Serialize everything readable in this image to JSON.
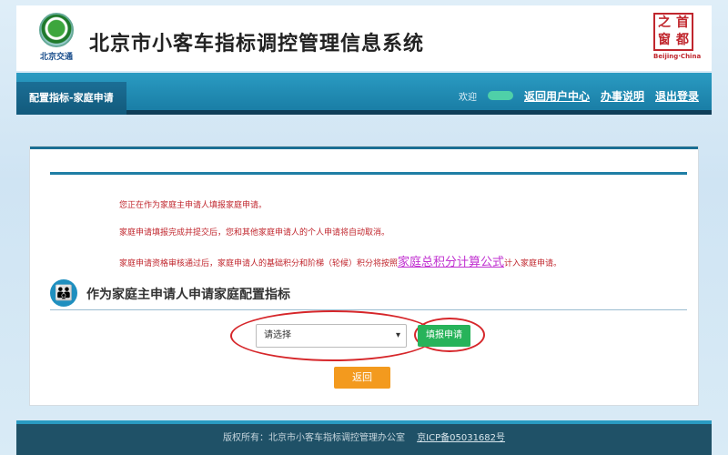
{
  "header": {
    "logo_caption": "北京交通",
    "title": "北京市小客车指标调控管理信息系统",
    "seal_chars": [
      "之",
      "首",
      "窗",
      "都"
    ],
    "seal_caption": "Beijing·China"
  },
  "nav": {
    "tab": "配置指标-家庭申请",
    "welcome": "欢迎",
    "links": [
      "返回用户中心",
      "办事说明",
      "退出登录"
    ]
  },
  "notices": {
    "line1": "您正在作为家庭主申请人填报家庭申请。",
    "line2": "家庭申请填报完成并提交后，您和其他家庭申请人的个人申请将自动取消。",
    "line3_prefix": "家庭申请资格审核通过后，家庭申请人的基础积分和阶梯（轮候）积分将按照",
    "line3_link": "家庭总积分计算公式",
    "line3_suffix": "计入家庭申请。"
  },
  "section": {
    "title": "作为家庭主申请人申请家庭配置指标"
  },
  "form": {
    "select_value": "请选择",
    "apply_label": "填报申请",
    "back_label": "返回"
  },
  "footer": {
    "copyright": "版权所有：北京市小客车指标调控管理办公室",
    "icp": "京ICP备05031682号"
  },
  "colors": {
    "nav_blue": "#1a7ea6",
    "notice_red": "#c0262d",
    "apply_green": "#27b35a",
    "back_orange": "#f39a1e",
    "link_magenta": "#c030d0",
    "annotation_red": "#d6262a"
  }
}
